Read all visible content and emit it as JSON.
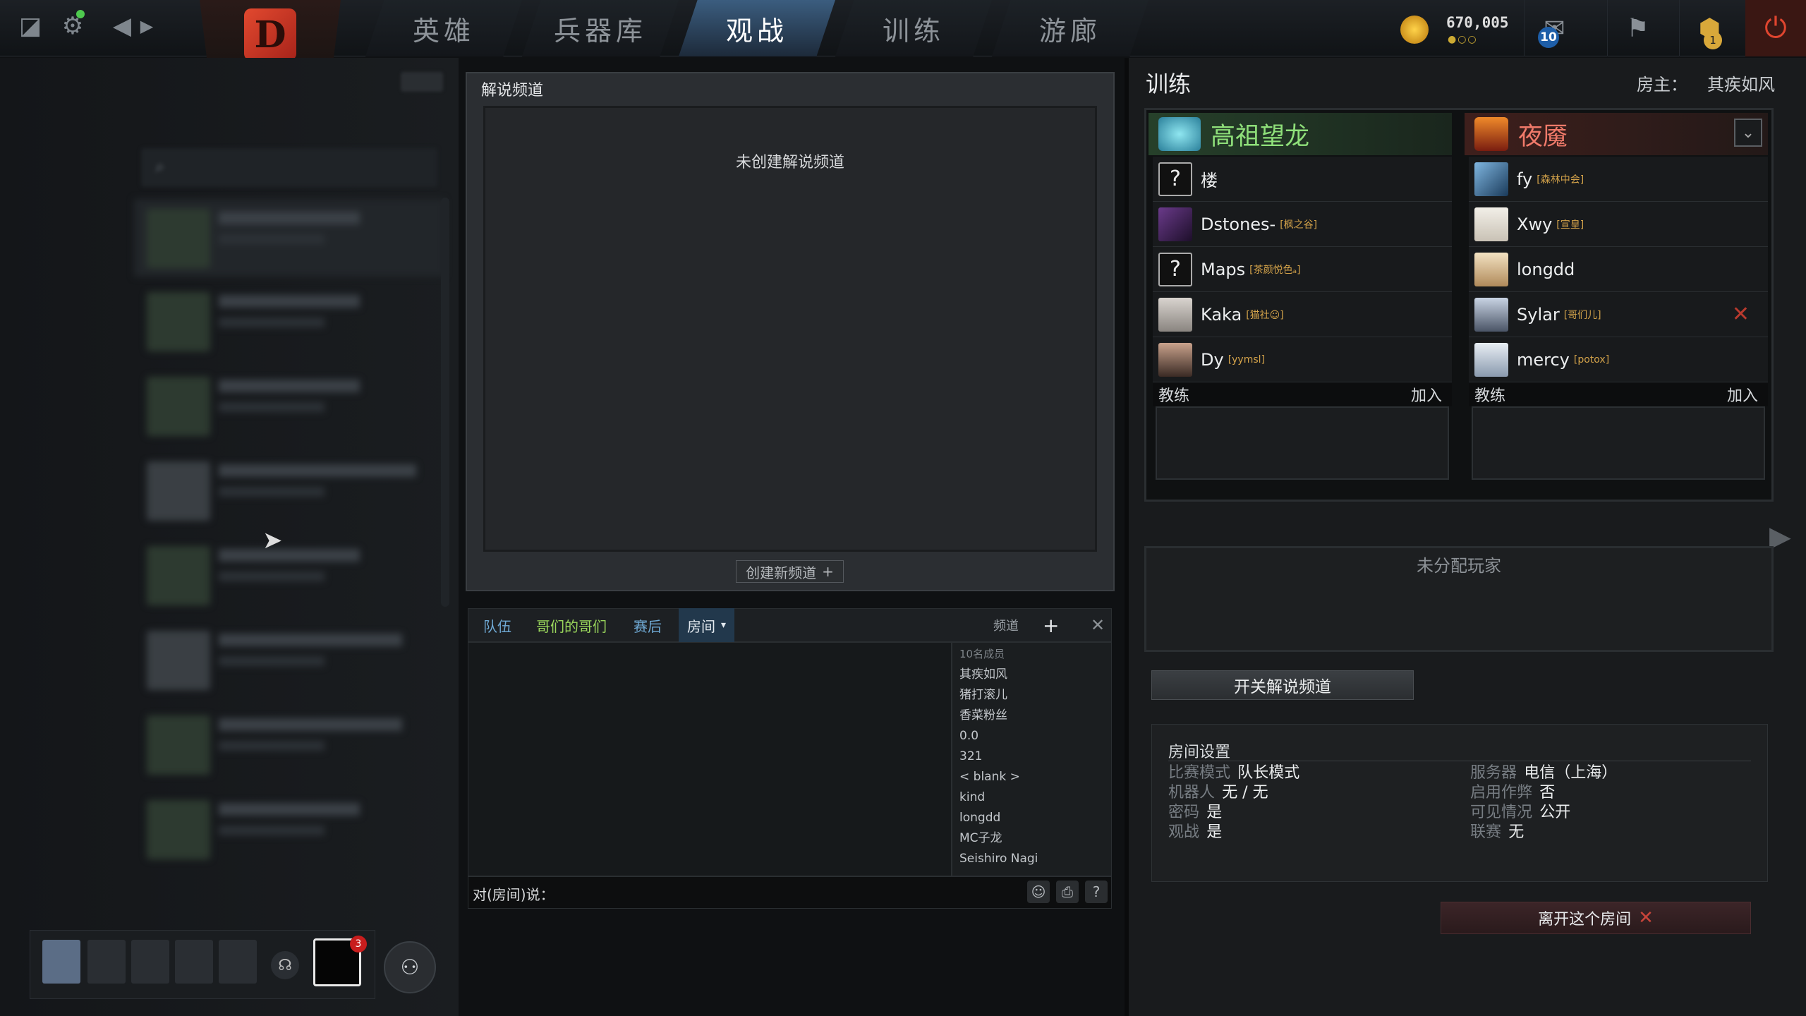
{
  "nav": {
    "tabs": [
      "英雄",
      "兵器库",
      "观战",
      "训练",
      "游廊"
    ],
    "active_tab": 2
  },
  "currency": {
    "gold": "670,005",
    "notifications": "10",
    "plus_badge": "1"
  },
  "party": {
    "tv_badge": "3"
  },
  "commentary": {
    "title": "解说频道",
    "empty": "未创建解说频道",
    "create_button": "创建新频道"
  },
  "chat": {
    "tabs": [
      "队伍",
      "哥们的哥们",
      "赛后",
      "房间"
    ],
    "channel_label": "频道",
    "members_header": "10名成员",
    "members": [
      "其疾如风",
      "猪打滚儿",
      "香菜粉丝",
      "0.0",
      "321",
      "< blank >",
      "kind",
      "longdd",
      "MC子龙",
      "Seishiro Nagi"
    ],
    "input_label": "对(房间)说："
  },
  "lobby": {
    "title": "训练",
    "host_label": "房主：",
    "host_name": "其疾如风",
    "radiant": {
      "name": "高祖望龙",
      "players": [
        {
          "name": "楼",
          "tag": ""
        },
        {
          "name": "Dstones-",
          "tag": "[枫之谷]"
        },
        {
          "name": "Maps",
          "tag": "[茶颜悦色ₐ]"
        },
        {
          "name": "Kaka",
          "tag": "[猫社☺]"
        },
        {
          "name": "Dy",
          "tag": "[yymsl]"
        }
      ]
    },
    "dire": {
      "name": "夜魇",
      "players": [
        {
          "name": "fy",
          "tag": "[森林中会]"
        },
        {
          "name": "Xwy",
          "tag": "[宣皇]"
        },
        {
          "name": "longdd",
          "tag": ""
        },
        {
          "name": "Sylar",
          "tag": "[哥们儿]"
        },
        {
          "name": "mercy",
          "tag": "[potox]"
        }
      ]
    },
    "coach_label": "教练",
    "join_label": "加入",
    "unassigned": "未分配玩家",
    "toggle_commentary": "开关解说频道",
    "settings": {
      "title": "房间设置",
      "rows_left": [
        {
          "k": "比赛模式",
          "v": "队长模式"
        },
        {
          "k": "机器人",
          "v": "无 / 无"
        },
        {
          "k": "密码",
          "v": "是"
        },
        {
          "k": "观战",
          "v": "是"
        }
      ],
      "rows_right": [
        {
          "k": "服务器",
          "v": "电信（上海）"
        },
        {
          "k": "启用作弊",
          "v": "否"
        },
        {
          "k": "可见情况",
          "v": "公开"
        },
        {
          "k": "联赛",
          "v": "无"
        }
      ]
    },
    "leave_button": "离开这个房间"
  },
  "colors": {
    "radiant": "#8fe07a",
    "dire": "#f07a6a",
    "active_tab": "#3b5d7f",
    "accent_gold": "#d4a34a"
  }
}
